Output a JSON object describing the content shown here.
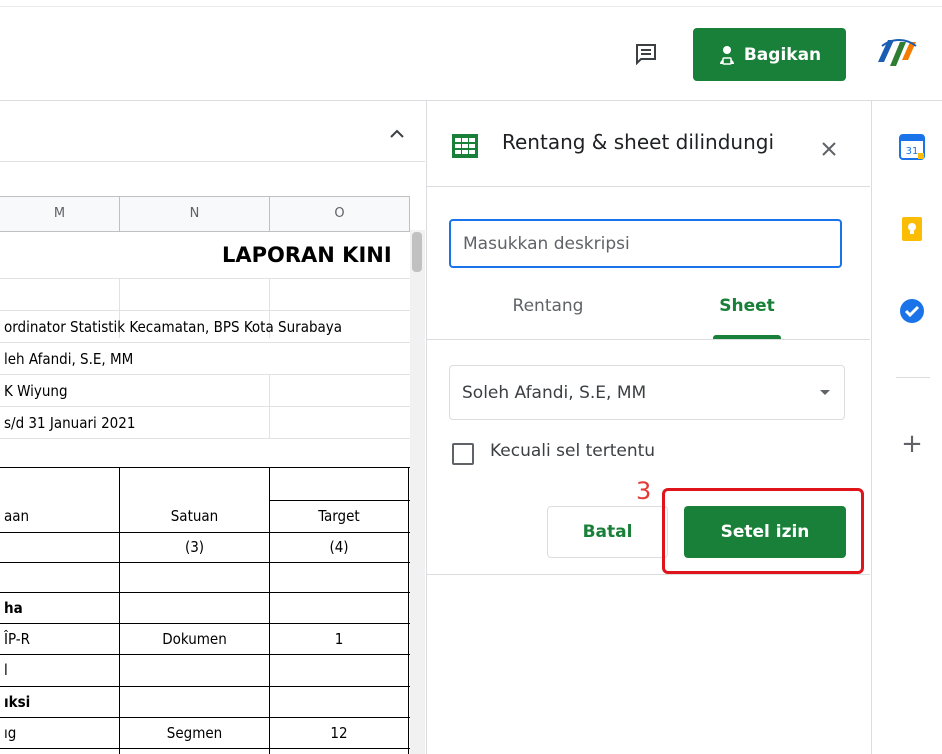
{
  "header": {
    "share_label": "Bagikan",
    "comment_icon": "comment-icon",
    "logo_icon": "bps-logo"
  },
  "sheet": {
    "columns": [
      "M",
      "N",
      "O"
    ],
    "title": "LAPORAN KINI",
    "rows": [
      "ordinator Statistik Kecamatan, BPS Kota Surabaya",
      "leh Afandi, S.E, MM",
      "K Wiyung",
      "s/d 31 Januari 2021"
    ],
    "table_headers": {
      "col_m": "aan",
      "col_n": "Satuan",
      "col_o": "Target"
    },
    "table_index": {
      "col_n": "(3)",
      "col_o": "(4)"
    },
    "section_1": "ha",
    "row_1": {
      "col_m": "ÎP-R",
      "col_n": "Dokumen",
      "col_o": "1"
    },
    "row_2": {
      "col_m": "l"
    },
    "section_2": "ıksi",
    "row_3": {
      "col_m": "ıg",
      "col_n": "Segmen",
      "col_o": "12"
    }
  },
  "panel": {
    "title": "Rentang & sheet dilindungi",
    "description_placeholder": "Masukkan deskripsi",
    "tabs": {
      "range": "Rentang",
      "sheet": "Sheet"
    },
    "selected_sheet": "Soleh Afandi, S.E, MM",
    "except_label": "Kecuali sel tertentu",
    "step_number": "3",
    "cancel_label": "Batal",
    "set_label": "Setel izin"
  },
  "rail": {
    "calendar_day": "31",
    "plus": "+"
  },
  "colors": {
    "brand_green": "#188038",
    "focus_blue": "#1a73e8",
    "highlight_red": "#e0141b"
  }
}
